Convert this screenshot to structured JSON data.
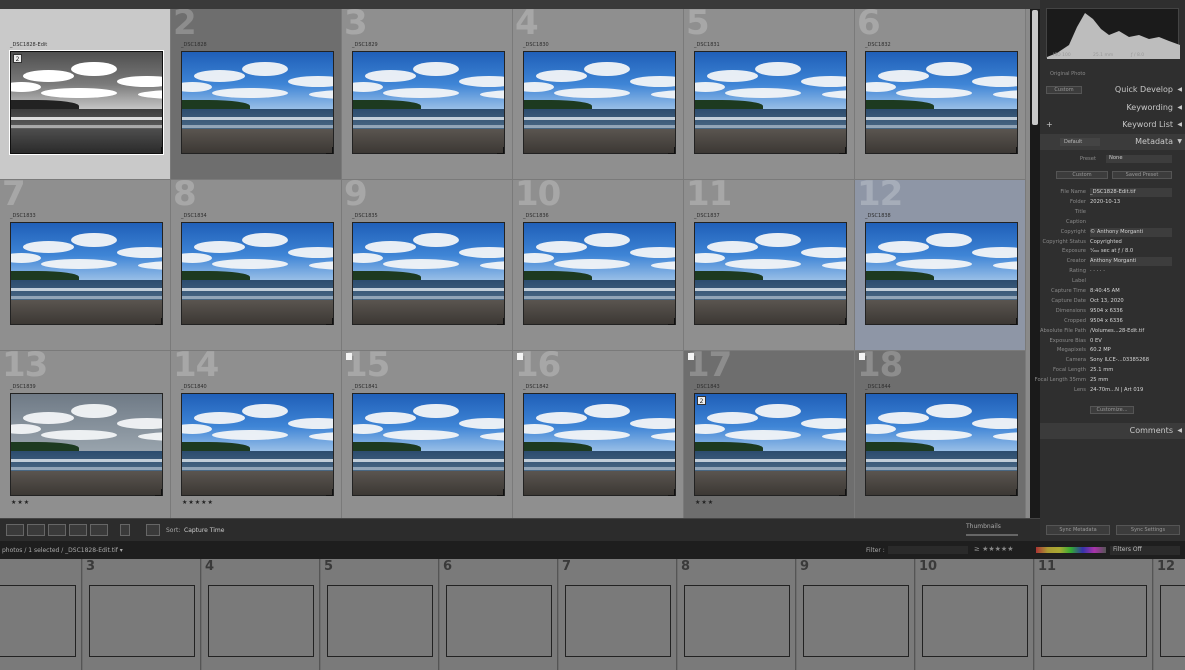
{
  "grid": {
    "cells": [
      {
        "num": "",
        "fname": "_DSC1828-Edit",
        "selected": true,
        "bw": true,
        "badge": "2"
      },
      {
        "num": "2",
        "fname": "_DSC1828",
        "dark": true
      },
      {
        "num": "3",
        "fname": "_DSC1829"
      },
      {
        "num": "4",
        "fname": "_DSC1830"
      },
      {
        "num": "5",
        "fname": "_DSC1831"
      },
      {
        "num": "6",
        "fname": "_DSC1832"
      },
      {
        "num": "7",
        "fname": "_DSC1833"
      },
      {
        "num": "8",
        "fname": "_DSC1834"
      },
      {
        "num": "9",
        "fname": "_DSC1835"
      },
      {
        "num": "10",
        "fname": "_DSC1836"
      },
      {
        "num": "11",
        "fname": "_DSC1837"
      },
      {
        "num": "12",
        "fname": "_DSC1838",
        "blue": true
      },
      {
        "num": "13",
        "fname": "_DSC1839",
        "grey": true,
        "stars": "★★★"
      },
      {
        "num": "14",
        "fname": "_DSC1840",
        "stars": "★★★★★"
      },
      {
        "num": "15",
        "fname": "_DSC1841",
        "flag": true
      },
      {
        "num": "16",
        "fname": "_DSC1842",
        "flag": true
      },
      {
        "num": "17",
        "fname": "_DSC1843",
        "flag": true,
        "dark": true,
        "badge": "2",
        "stars": "★★★"
      },
      {
        "num": "18",
        "fname": "_DSC1844",
        "flag": true,
        "dark": true
      }
    ]
  },
  "toolbar": {
    "sort_label": "Sort:",
    "sort_value": "Capture Time",
    "thumbnails_label": "Thumbnails"
  },
  "filmstrip_bar": {
    "path": "photos / 1 selected / _DSC1828-Edit.tif ▾",
    "filter_label": "Filter :",
    "filters_off": "Filters Off"
  },
  "filmstrip": {
    "cells": [
      "",
      "3",
      "4",
      "5",
      "6",
      "7",
      "8",
      "9",
      "10",
      "11",
      "12"
    ]
  },
  "right_panel": {
    "original_photo": "Original Photo",
    "quick_develop": "Quick Develop",
    "keywording": "Keywording",
    "keyword_list": "Keyword List",
    "metadata": "Metadata",
    "default_preset": "Default",
    "preset_label": "Preset",
    "preset_value": "None",
    "custom_label": "Custom",
    "saved_preset": "Saved Preset",
    "comments": "Comments",
    "sync_metadata": "Sync Metadata",
    "sync_settings": "Sync Settings",
    "histo_info": [
      "ISO 100",
      "25.1 mm",
      "ƒ / 8.0"
    ],
    "meta": [
      {
        "k": "File Name",
        "v": "_DSC1828-Edit.tif",
        "field": true
      },
      {
        "k": "Folder",
        "v": "2020-10-13"
      },
      {
        "k": "Title",
        "v": "",
        "field": true
      },
      {
        "k": "Caption",
        "v": "",
        "field": true
      },
      {
        "k": "Copyright",
        "v": "© Anthony Morganti",
        "field": true
      },
      {
        "k": "Copyright Status",
        "v": "Copyrighted"
      },
      {
        "k": "Exposure",
        "v": "¹⁄₂₀₀ sec at ƒ / 8.0"
      },
      {
        "k": "Creator",
        "v": "Anthony Morganti",
        "field": true
      },
      {
        "k": "Rating",
        "v": "· · · · ·"
      },
      {
        "k": "Label",
        "v": "",
        "field": true
      },
      {
        "k": "Capture Time",
        "v": "8:40:45 AM"
      },
      {
        "k": "Capture Date",
        "v": "Oct 13, 2020"
      },
      {
        "k": "Dimensions",
        "v": "9504 x 6336"
      },
      {
        "k": "Cropped",
        "v": "9504 x 6336"
      },
      {
        "k": "Absolute File Path",
        "v": "/Volumes...28-Edit.tif"
      },
      {
        "k": "Exposure Bias",
        "v": "0 EV"
      },
      {
        "k": "Megapixels",
        "v": "60.2 MP"
      },
      {
        "k": "Camera",
        "v": "Sony ILCE-...03385268"
      },
      {
        "k": "Focal Length",
        "v": "25.1 mm"
      },
      {
        "k": "Focal Length 35mm",
        "v": "25 mm"
      },
      {
        "k": "Lens",
        "v": "24-70m...N | Art 019"
      }
    ],
    "customize": "Customize..."
  }
}
